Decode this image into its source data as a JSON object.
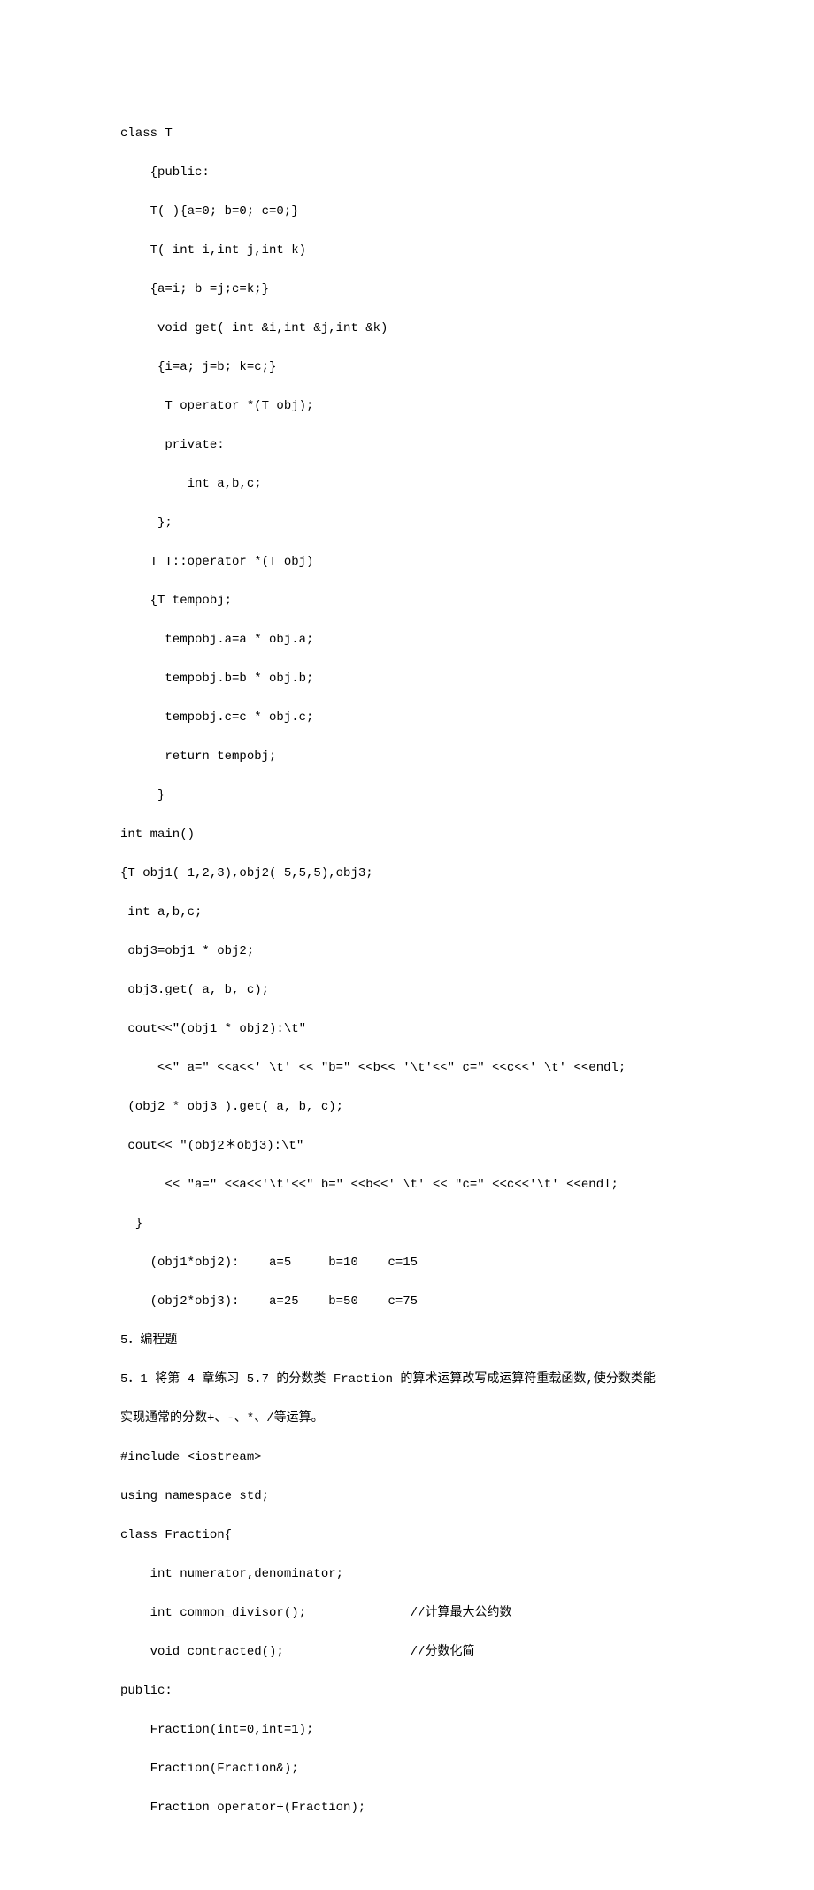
{
  "lines": {
    "l0": "class T",
    "l1": "    {public:",
    "l2": "    T( ){a=0; b=0; c=0;}",
    "l3": "    T( int i,int j,int k)",
    "l4": "    {a=i; b =j;c=k;}",
    "l5": "     void get( int &i,int &j,int &k)",
    "l6": "     {i=a; j=b; k=c;}",
    "l7": "      T operator *(T obj);",
    "l8": "      private:",
    "l9": "         int a,b,c;",
    "l10": "     };",
    "l11": "    T T::operator *(T obj)",
    "l12": "    {T tempobj;",
    "l13": "      tempobj.a=a * obj.a;",
    "l14": "      tempobj.b=b * obj.b;",
    "l15": "      tempobj.c=c * obj.c;",
    "l16": "      return tempobj;",
    "l17": "     }",
    "l18": "int main()",
    "l19": "{T obj1( 1,2,3),obj2( 5,5,5),obj3;",
    "l20": " int a,b,c;",
    "l21": " obj3=obj1 * obj2;",
    "l22": " obj3.get( a, b, c);",
    "l23": " cout<<\"(obj1 * obj2):\\t\"",
    "l24": "     <<\" a=\" <<a<<' \\t' << \"b=\" <<b<< '\\t'<<\" c=\" <<c<<' \\t' <<endl;",
    "l25": " (obj2 * obj3 ).get( a, b, c);",
    "l26": " cout<< \"(obj2＊obj3):\\t\"",
    "l27": "      << \"a=\" <<a<<'\\t'<<\" b=\" <<b<<' \\t' << \"c=\" <<c<<'\\t' <<endl;",
    "l28": "  }",
    "l29": "    (obj1*obj2):    a=5     b=10    c=15",
    "l30": "    (obj2*obj3):    a=25    b=50    c=75",
    "l31": "5．编程题",
    "l32": "5．1 将第 4 章练习 5.7 的分数类 Fraction 的算术运算改写成运算符重载函数,使分数类能",
    "l33": "实现通常的分数+、-、*、/等运算。",
    "l34": "#include <iostream>",
    "l35": "using namespace std;",
    "l36": "class Fraction{",
    "l37": "    int numerator,denominator;",
    "l38": "    int common_divisor();              //计算最大公约数",
    "l39": "    void contracted();                 //分数化简",
    "l40": "public:",
    "l41": "    Fraction(int=0,int=1);",
    "l42": "    Fraction(Fraction&);",
    "l43": "    Fraction operator+(Fraction);"
  }
}
